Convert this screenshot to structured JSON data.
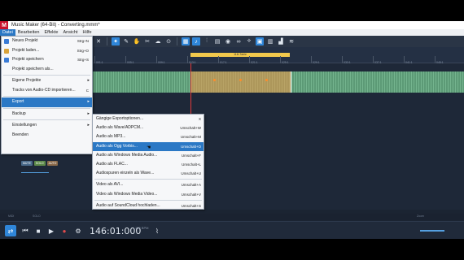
{
  "window": {
    "title": "Music Maker (64-Bit) - Converting.mmm*",
    "logo": "M"
  },
  "menubar": {
    "items": [
      "Datei",
      "Bearbeiten",
      "Effekte",
      "Ansicht",
      "Hilfe"
    ]
  },
  "file_menu": {
    "items": [
      {
        "label": "Neues Projekt",
        "shortcut": "Strg+N"
      },
      {
        "label": "Projekt laden...",
        "shortcut": "Strg+O"
      },
      {
        "label": "Projekt speichern",
        "shortcut": "Strg+S"
      },
      {
        "label": "Projekt speichern als...",
        "shortcut": ""
      },
      {
        "label": "Eigene Projekte",
        "shortcut": ""
      },
      {
        "label": "Tracks von Audio-CD importieren...",
        "shortcut": "C"
      },
      {
        "label": "Export",
        "shortcut": ""
      },
      {
        "label": "Backup",
        "shortcut": ""
      },
      {
        "label": "Einstellungen",
        "shortcut": ""
      },
      {
        "label": "Beenden",
        "shortcut": ""
      }
    ]
  },
  "export_menu": {
    "items": [
      {
        "label": "Gängige Exportoptionen...",
        "shortcut": "X"
      },
      {
        "label": "Audio als Wave/ADPCM...",
        "shortcut": "Umschalt+W"
      },
      {
        "label": "Audio als MP3...",
        "shortcut": "Umschalt+M"
      },
      {
        "label": "Audio als Ogg Vorbis...",
        "shortcut": "Umschalt+O"
      },
      {
        "label": "Audio als Windows Media Audio...",
        "shortcut": "Umschalt+F"
      },
      {
        "label": "Audio als FLAC...",
        "shortcut": "Umschalt+L"
      },
      {
        "label": "Audiospuren einzeln als Wave...",
        "shortcut": "Umschalt+U"
      },
      {
        "label": "Video als AVI...",
        "shortcut": "Umschalt+A"
      },
      {
        "label": "Video als Windows Media Video...",
        "shortcut": "Umschalt+V"
      },
      {
        "label": "Audio auf SoundCloud hochladen...",
        "shortcut": "Umschalt+S"
      }
    ],
    "selected_index": 3
  },
  "timeline": {
    "range_label": "11th Table",
    "ticks": [
      "001:1",
      "005:1",
      "009:1",
      "013:1",
      "017:1",
      "021:1",
      "025:1",
      "029:1",
      "033:1",
      "037:1",
      "041:1",
      "045:1"
    ]
  },
  "track": {
    "pills": [
      "MUTE",
      "SOLO",
      "AUTO"
    ]
  },
  "status": {
    "left": "MIDI",
    "mid": "SOLO",
    "zoom_label": "Zoom"
  },
  "transport": {
    "time": "146:01:000",
    "bpm": "120 BPM"
  },
  "colors": {
    "accent": "#2b78c5",
    "track": "#5c9a76",
    "selection": "#f0964a",
    "range": "#f2c94c",
    "record": "#e14b4b"
  }
}
